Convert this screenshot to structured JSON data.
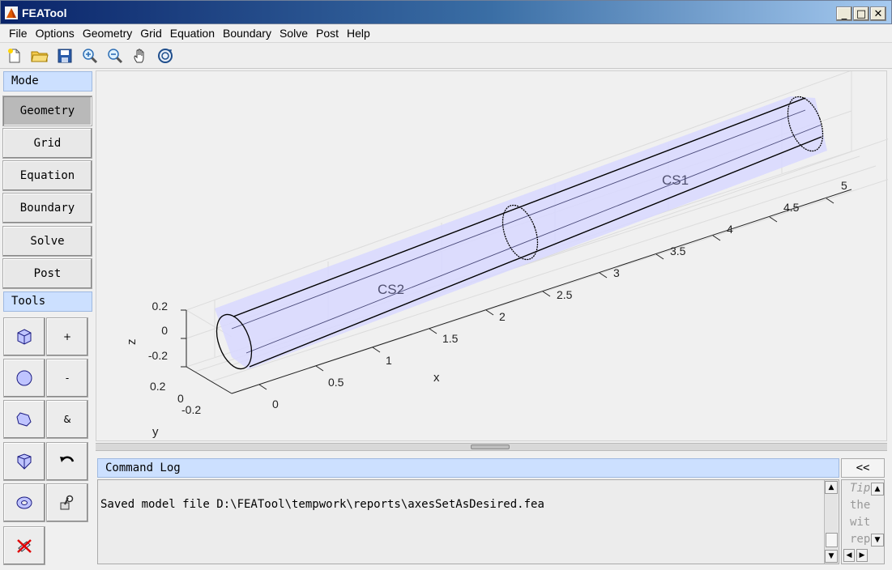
{
  "window": {
    "title": "FEATool",
    "minimize": "_",
    "maximize": "□",
    "close": "✕"
  },
  "menu": [
    "File",
    "Options",
    "Geometry",
    "Grid",
    "Equation",
    "Boundary",
    "Solve",
    "Post",
    "Help"
  ],
  "toolbar": [
    "new-file-icon",
    "open-folder-icon",
    "save-icon",
    "zoom-in-icon",
    "zoom-out-icon",
    "pan-hand-icon",
    "rotate-3d-icon"
  ],
  "sidebar": {
    "mode_header": "Mode",
    "modes": [
      {
        "label": "Geometry",
        "active": true
      },
      {
        "label": "Grid",
        "active": false
      },
      {
        "label": "Equation",
        "active": false
      },
      {
        "label": "Boundary",
        "active": false
      },
      {
        "label": "Solve",
        "active": false
      },
      {
        "label": "Post",
        "active": false
      }
    ],
    "tools_header": "Tools",
    "tools": [
      {
        "icon": "cube-icon",
        "label": ""
      },
      {
        "icon": "",
        "label": "+"
      },
      {
        "icon": "circle-icon",
        "label": ""
      },
      {
        "icon": "",
        "label": "-"
      },
      {
        "icon": "polygon-icon",
        "label": ""
      },
      {
        "icon": "",
        "label": "&"
      },
      {
        "icon": "box-3d-icon",
        "label": ""
      },
      {
        "icon": "undo-icon",
        "label": ""
      },
      {
        "icon": "torus-icon",
        "label": ""
      },
      {
        "icon": "inspect-icon",
        "label": ""
      },
      {
        "icon": "delete-icon",
        "label": ""
      }
    ]
  },
  "plot": {
    "labels": [
      "CS1",
      "CS2"
    ],
    "x_label": "x",
    "y_label": "y",
    "z_label": "z",
    "x_ticks": [
      "0",
      "0.5",
      "1",
      "1.5",
      "2",
      "2.5",
      "3",
      "3.5",
      "4",
      "4.5",
      "5"
    ],
    "y_ticks": [
      "0.2",
      "0",
      "-0.2"
    ],
    "z_ticks": [
      "0.2",
      "0",
      "-0.2"
    ],
    "colors": {
      "fill": "#d8d8ff",
      "edge": "#000000",
      "grid": "#dcdcdc"
    }
  },
  "command_log": {
    "header": "Command Log",
    "collapse_label": "<<",
    "text": "Saved model file D:\\FEATool\\tempwork\\reports\\axesSetAsDesired.fea",
    "tips": [
      "Tip",
      "the",
      "wit",
      "rep"
    ]
  }
}
